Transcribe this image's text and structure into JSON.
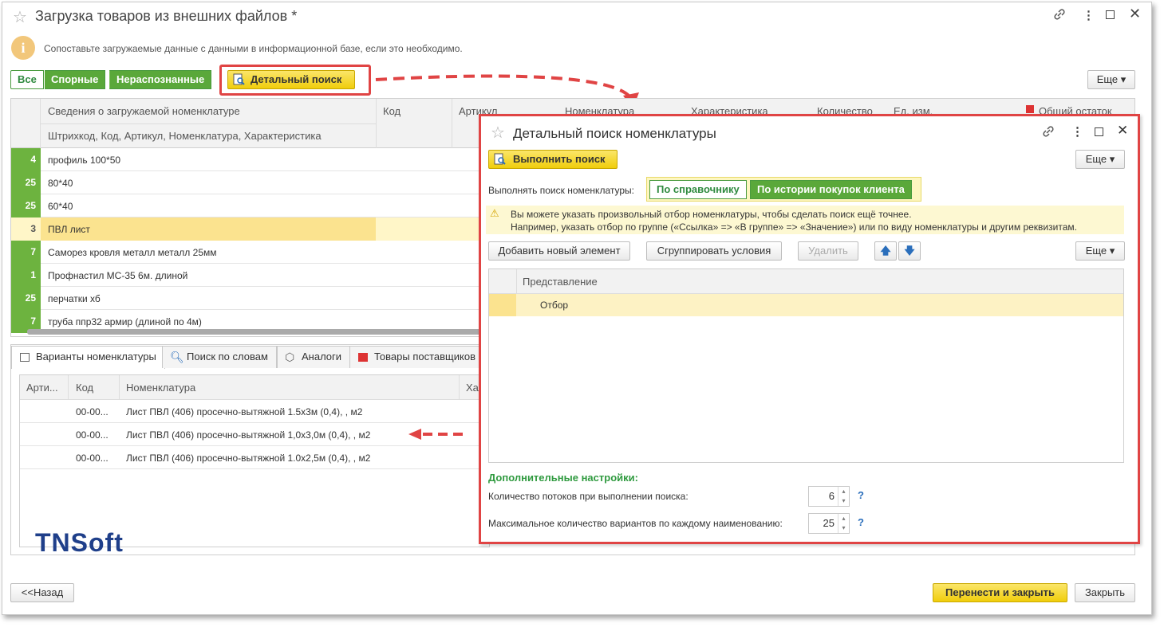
{
  "window": {
    "title": "Загрузка товаров из внешних файлов *",
    "info_text": "Сопоставьте загружаемые данные с данными в информационной базе, если это необходимо."
  },
  "filters": {
    "all": "Все",
    "disputed": "Спорные",
    "unrecognized": "Нераспознанные",
    "detailed_search": "Детальный поиск"
  },
  "more_label": "Еще",
  "main_table": {
    "header_top": "Сведения о загружаемой номенклатуре",
    "header_sub": "Штрихкод, Код, Артикул, Номенклатура, Характеристика",
    "columns": [
      "Код",
      "Артикул",
      "Номенклатура",
      "Характеристика",
      "Количество",
      "Ед. изм.",
      "Общий остаток"
    ],
    "rows": [
      {
        "num": "4",
        "name": "профиль 100*50"
      },
      {
        "num": "25",
        "name": "80*40"
      },
      {
        "num": "25",
        "name": "60*40"
      },
      {
        "num": "3",
        "name": "ПВЛ лист"
      },
      {
        "num": "7",
        "name": "Саморез кровля металл металл 25мм"
      },
      {
        "num": "1",
        "name": "Профнастил МС-35 6м. длиной"
      },
      {
        "num": "25",
        "name": "перчатки хб"
      },
      {
        "num": "7",
        "name": "труба ппр32 армир (длиной по 4м)"
      }
    ]
  },
  "tabs": [
    "Варианты номенклатуры",
    "Поиск по словам",
    "Аналоги",
    "Товары поставщиков"
  ],
  "variants": {
    "columns": [
      "Арти...",
      "Код",
      "Номенклатура",
      "Ха"
    ],
    "rows": [
      {
        "code": "00-00...",
        "name": "Лист ПВЛ (406) просечно-вытяжной 1.5х3м (0,4), , м2"
      },
      {
        "code": "00-00...",
        "name": "Лист ПВЛ (406) просечно-вытяжной 1,0х3,0м (0,4), , м2"
      },
      {
        "code": "00-00...",
        "name": "Лист ПВЛ (406) просечно-вытяжной 1.0х2,5м (0,4), , м2"
      }
    ]
  },
  "logo": "TNSoft",
  "footer": {
    "back": "<<Назад",
    "transfer": "Перенести и закрыть",
    "close": "Закрыть"
  },
  "dialog": {
    "title": "Детальный поиск номенклатуры",
    "run_search": "Выполнить поиск",
    "search_mode_label": "Выполнять поиск номенклатуры:",
    "mode_catalog": "По справочнику",
    "mode_history": "По истории покупок клиента",
    "warn_line1": "Вы можете указать произвольный отбор номенклатуры, чтобы сделать поиск ещё точнее.",
    "warn_line2": "Например, указать отбор по группе («Ссылка» => «В группе» => «Значение») или по виду номенклатуры и другим реквизитам.",
    "add_element": "Добавить новый элемент",
    "group_conditions": "Сгруппировать условия",
    "delete": "Удалить",
    "col_representation": "Представление",
    "filter_row": "Отбор",
    "additional_settings": "Дополнительные настройки:",
    "threads_label": "Количество потоков при выполнении поиска:",
    "threads_value": "6",
    "max_variants_label": "Максимальное количество вариантов по каждому наименованию:",
    "max_variants_value": "25",
    "help": "?"
  },
  "colors": {
    "accent_green": "#6db33f",
    "highlight_red": "#e04444",
    "button_yellow": "#f0cd0c",
    "selected_row": "#fbe38f"
  }
}
